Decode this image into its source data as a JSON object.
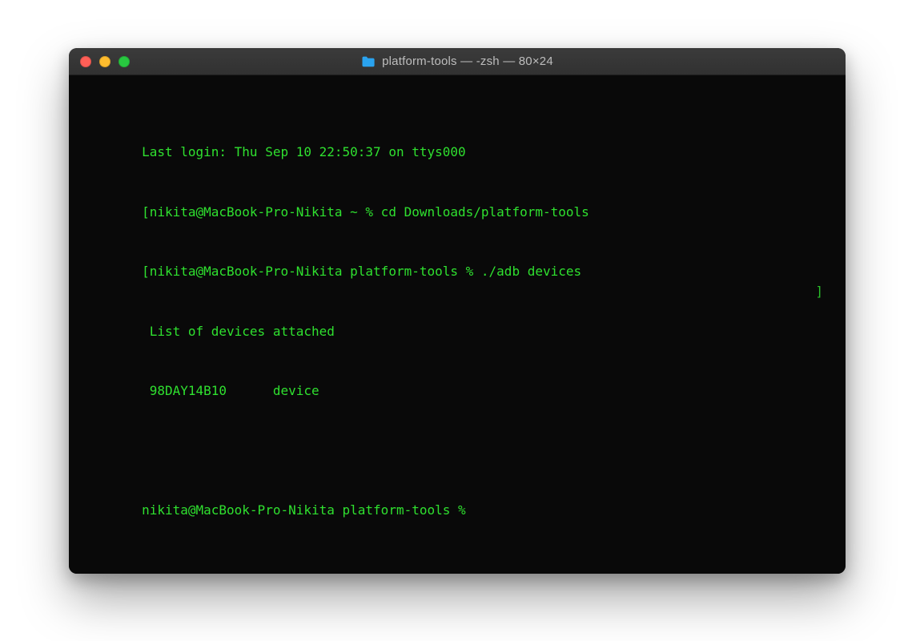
{
  "window": {
    "title": "platform-tools — -zsh — 80×24"
  },
  "colors": {
    "text": "#2fe02f",
    "bg": "#090909",
    "titlebar_text": "#bdbdbd",
    "red": "#ff5f57",
    "yellow": "#febc2e",
    "green": "#28c840",
    "folder": "#2aa3ef"
  },
  "terminal": {
    "last_login": "Last login: Thu Sep 10 22:50:37 on ttys000",
    "line1_left": "[nikita@MacBook-Pro-Nikita ~ % cd Downloads/platform-tools",
    "line2_left": "[nikita@MacBook-Pro-Nikita platform-tools % ./adb devices",
    "right_bracket": "]",
    "output1": " List of devices attached",
    "output2": " 98DAY14B10      device",
    "prompt": "nikita@MacBook-Pro-Nikita platform-tools % "
  }
}
